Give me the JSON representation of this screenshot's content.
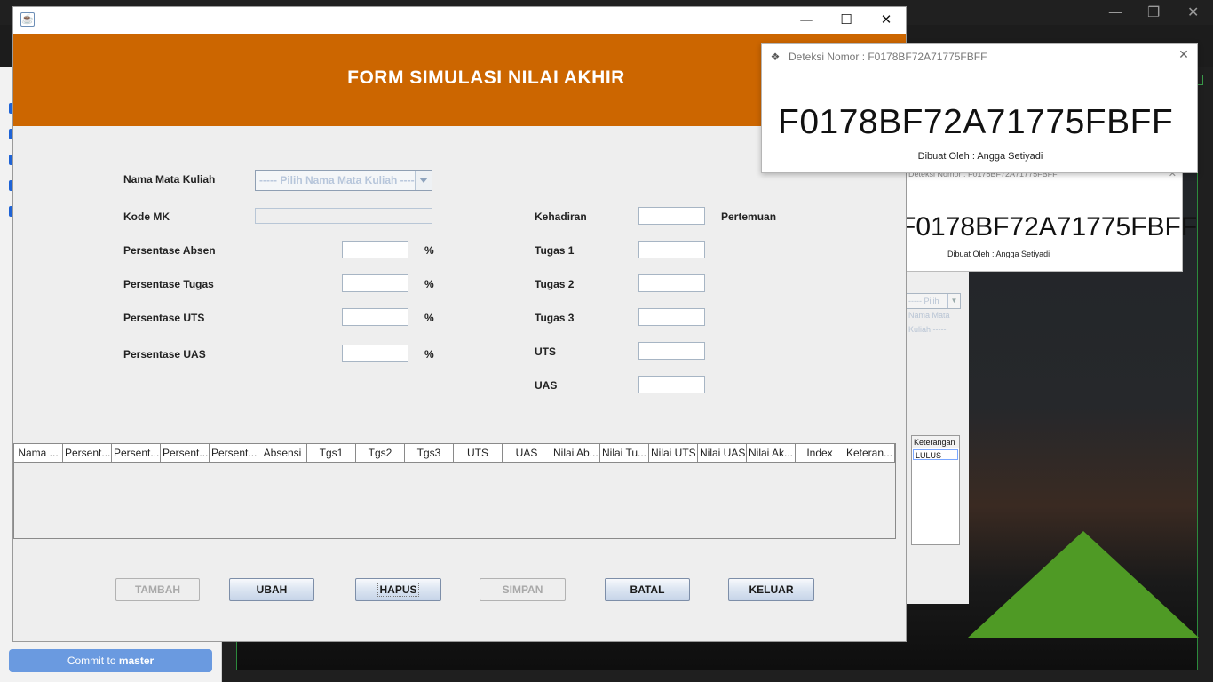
{
  "background": {
    "commit_button": {
      "prefix": "Commit to ",
      "branch": "master"
    },
    "window_controls": [
      "—",
      "❐",
      "✕"
    ],
    "popup_copy": {
      "title": "Deteksi Nomor : F0178BF72A71775FBFF",
      "serial": "F0178BF72A71775FBFF",
      "by": "Dibuat Oleh : Angga Setiyadi"
    },
    "form_copy": {
      "combo_text": "----- Pilih Nama Mata Kuliah -----",
      "table_header": "Keterangan",
      "table_cell": "LULUS"
    }
  },
  "window": {
    "title": "",
    "icon": "java-cup-icon",
    "controls": {
      "minimize": "—",
      "maximize": "☐",
      "close": "✕"
    },
    "banner_title": "FORM SIMULASI NILAI AKHIR",
    "banner_color": "#cc6600"
  },
  "form": {
    "nama_mk_label": "Nama Mata Kuliah",
    "nama_mk_placeholder": "----- Pilih Nama Mata Kuliah -----",
    "kode_mk_label": "Kode MK",
    "kode_mk_value": "",
    "persen_absen_label": "Persentase Absen",
    "persen_tugas_label": "Persentase Tugas",
    "persen_uts_label": "Persentase UTS",
    "persen_uas_label": "Persentase UAS",
    "percent_sign": "%",
    "kehadiran_label": "Kehadiran",
    "pertemuan_label": "Pertemuan",
    "tugas1_label": "Tugas 1",
    "tugas2_label": "Tugas 2",
    "tugas3_label": "Tugas 3",
    "uts_label": "UTS",
    "uas_label": "UAS"
  },
  "table": {
    "columns": [
      "Nama ...",
      "Persent...",
      "Persent...",
      "Persent...",
      "Persent...",
      "Absensi",
      "Tgs1",
      "Tgs2",
      "Tgs3",
      "UTS",
      "UAS",
      "Nilai Ab...",
      "Nilai Tu...",
      "Nilai UTS",
      "Nilai UAS",
      "Nilai Ak...",
      "Index",
      "Keteran..."
    ],
    "rows": []
  },
  "buttons": {
    "tambah": "TAMBAH",
    "ubah": "UBAH",
    "hapus": "HAPUS",
    "simpan": "SIMPAN",
    "batal": "BATAL",
    "keluar": "KELUAR"
  },
  "popup": {
    "title": "Deteksi Nomor : F0178BF72A71775FBFF",
    "serial": "F0178BF72A71775FBFF",
    "by": "Dibuat Oleh : Angga Setiyadi",
    "close": "✕"
  }
}
